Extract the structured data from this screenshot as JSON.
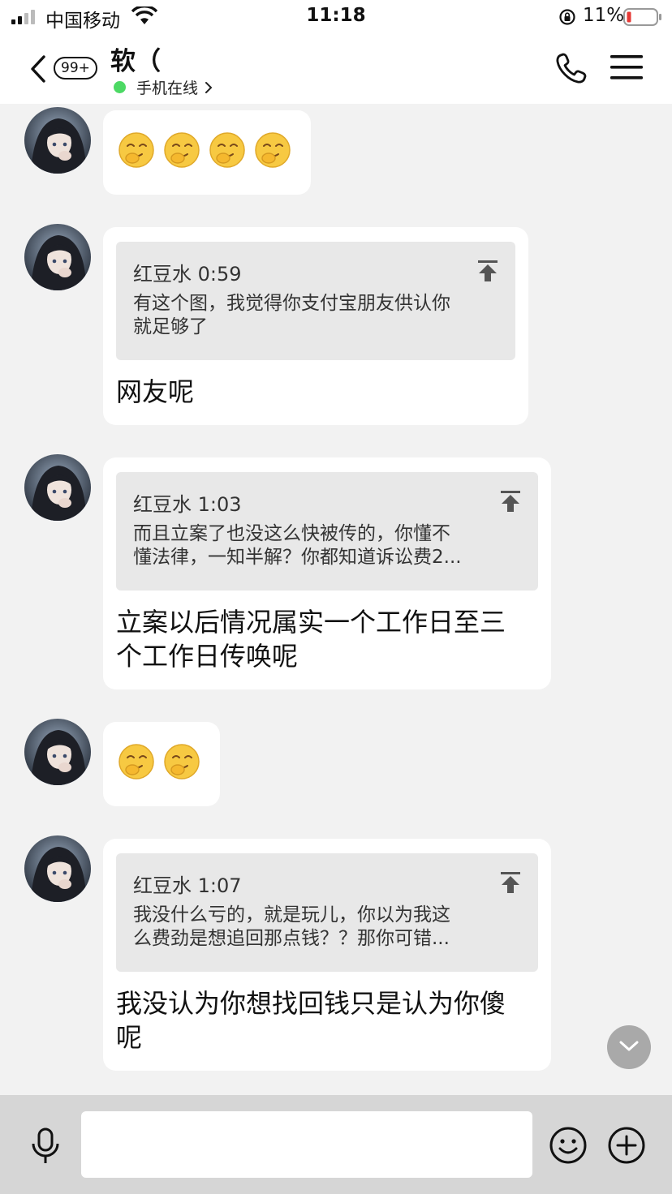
{
  "status_bar": {
    "carrier": "中国移动",
    "time": "11:18",
    "battery": "11%"
  },
  "header": {
    "unread_badge": "99+",
    "title": "软（",
    "status": "手机在线"
  },
  "messages": [
    {
      "type": "emoji",
      "count": 4
    },
    {
      "type": "quote-reply",
      "quote_head": "红豆水 0:59",
      "quote_body": "有这个图，我觉得你支付宝朋友供认你\n就足够了",
      "reply": "网友呢"
    },
    {
      "type": "quote-reply",
      "quote_head": "红豆水 1:03",
      "quote_body": "而且立案了也没这么快被传的，你懂不\n懂法律，一知半解？你都知道诉讼费2...",
      "reply": "立案以后情况属实一个工作日至三\n个工作日传唤呢"
    },
    {
      "type": "emoji",
      "count": 2
    },
    {
      "type": "quote-reply",
      "quote_head": "红豆水 1:07",
      "quote_body": "我没什么亏的，就是玩儿，你以为我这\n么费劲是想追回那点钱？？那你可错...",
      "reply": "我没认为你想找回钱只是认为你傻\n呢"
    }
  ],
  "input": {
    "placeholder": ""
  },
  "icons": {
    "back": "chevron-left-icon",
    "phone": "phone-icon",
    "menu": "hamburger-menu-icon",
    "mic": "microphone-icon",
    "emoji": "smiley-icon",
    "plus": "plus-circle-icon",
    "quote": "jump-to-top-icon",
    "scroll": "chevron-down-icon"
  },
  "colors": {
    "online": "#4cd964",
    "battery_low": "#e53935",
    "background": "#f2f2f2",
    "input_bar": "#d6d6d6"
  }
}
